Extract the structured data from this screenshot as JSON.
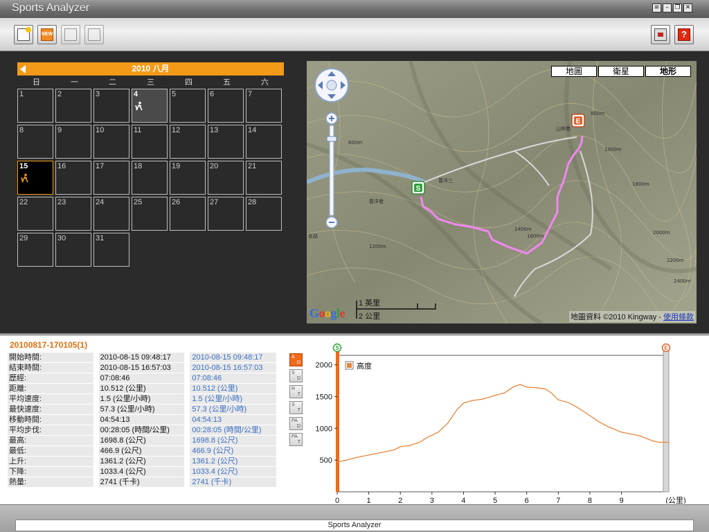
{
  "window": {
    "title": "Sports Analyzer"
  },
  "toolbar": {
    "buttons": [
      "add-icon",
      "new-icon",
      "import-icon",
      "export-icon"
    ],
    "new_label": "NEW",
    "help_label": "?"
  },
  "calendar": {
    "month_label": "2010 八月",
    "weekdays": [
      "日",
      "一",
      "二",
      "三",
      "四",
      "五",
      "六"
    ],
    "days": [
      "1",
      "2",
      "3",
      "4",
      "5",
      "6",
      "7",
      "8",
      "9",
      "10",
      "11",
      "12",
      "13",
      "14",
      "15",
      "16",
      "17",
      "18",
      "19",
      "20",
      "21",
      "22",
      "23",
      "24",
      "25",
      "26",
      "27",
      "28",
      "29",
      "30",
      "31"
    ],
    "activity_days": [
      "4",
      "15"
    ],
    "selected_day": "15",
    "accent": "#f39a19"
  },
  "map": {
    "types": [
      "地圖",
      "衛星",
      "地形"
    ],
    "active_type": "地形",
    "start_marker": "S",
    "end_marker": "E",
    "scale_mi": "1 英里",
    "scale_km": "2 公里",
    "logo": "Google",
    "attribution": "地圖資料 ©2010 Kingway - ",
    "terms_link": "使用條款",
    "contour_labels": [
      "600m",
      "800m",
      "1000m",
      "1200m",
      "1400m",
      "1600m",
      "1800m",
      "2000m",
      "2200m",
      "2400m"
    ],
    "road_labels": [
      "山林巷",
      "春洋巷",
      "春洋三",
      "名路"
    ],
    "track_color": "#f088f0"
  },
  "session": {
    "title": "20100817-170105(1)",
    "rows": [
      {
        "label": "開始時間:",
        "value": "2010-08-15 09:48:17",
        "value2": "2010-08-15 09:48:17"
      },
      {
        "label": "結束時間:",
        "value": "2010-08-15 16:57:03",
        "value2": "2010-08-15 16:57:03"
      },
      {
        "label": "歷經:",
        "value": "07:08:46",
        "value2": "07:08:46"
      },
      {
        "label": "距離:",
        "value": "10.512 (公里)",
        "value2": "10.512 (公里)"
      },
      {
        "label": "平均速度:",
        "value": "1.5 (公里/小時)",
        "value2": "1.5 (公里/小時)"
      },
      {
        "label": "最快速度:",
        "value": "57.3 (公里/小時)",
        "value2": "57.3 (公里/小時)"
      },
      {
        "label": "移動時間:",
        "value": "04:54:13",
        "value2": "04:54:13"
      },
      {
        "label": "平均步伐:",
        "value": "00:28:05 (時間/公里)",
        "value2": "00:28:05 (時間/公里)"
      },
      {
        "label": "最高:",
        "value": "1698.8 (公尺)",
        "value2": "1698.8 (公尺)"
      },
      {
        "label": "最低:",
        "value": "466.9 (公尺)",
        "value2": "466.9 (公尺)"
      },
      {
        "label": "上升:",
        "value": "1361.2 (公尺)",
        "value2": "1361.2 (公尺)"
      },
      {
        "label": "下降:",
        "value": "1033.4 (公尺)",
        "value2": "1033.4 (公尺)"
      },
      {
        "label": "熱量:",
        "value": "2741 (千卡)",
        "value2": "2741 (千卡)"
      }
    ]
  },
  "chart_modes": [
    {
      "top": "A",
      "bottom": "D"
    },
    {
      "top": "S",
      "bottom": "D"
    },
    {
      "top": "R",
      "bottom": "T"
    },
    {
      "top": "S",
      "bottom": "T"
    },
    {
      "top": "PA",
      "bottom": "D"
    },
    {
      "top": "PA",
      "bottom": "T"
    }
  ],
  "chart_data": {
    "type": "line",
    "title": "",
    "xlabel": "(公里)",
    "ylabel": "",
    "xlim": [
      0,
      10.5
    ],
    "ylim": [
      0,
      2150
    ],
    "xticks": [
      "0",
      "1",
      "2",
      "3",
      "4",
      "5",
      "6",
      "7",
      "8",
      "9"
    ],
    "yticks": [
      "500",
      "1000",
      "1500",
      "2000"
    ],
    "legend": "top-left",
    "start_marker": "S",
    "end_marker": "E",
    "series": [
      {
        "name": "高度",
        "color": "#e8853a",
        "x": [
          0,
          0.3,
          0.6,
          1.0,
          1.4,
          1.8,
          2.0,
          2.3,
          2.6,
          2.9,
          3.2,
          3.5,
          3.8,
          4.0,
          4.3,
          4.6,
          5.0,
          5.3,
          5.6,
          5.8,
          6.0,
          6.3,
          6.6,
          6.8,
          7.0,
          7.3,
          7.6,
          8.0,
          8.3,
          8.6,
          9.0,
          9.3,
          9.6,
          10.0,
          10.2,
          10.5
        ],
        "y": [
          470,
          500,
          540,
          580,
          620,
          660,
          710,
          730,
          780,
          870,
          940,
          1080,
          1300,
          1400,
          1440,
          1460,
          1520,
          1560,
          1660,
          1690,
          1650,
          1640,
          1620,
          1550,
          1450,
          1410,
          1330,
          1200,
          1100,
          1020,
          940,
          910,
          880,
          800,
          780,
          780
        ]
      }
    ]
  },
  "status": {
    "text": "Sports Analyzer"
  }
}
